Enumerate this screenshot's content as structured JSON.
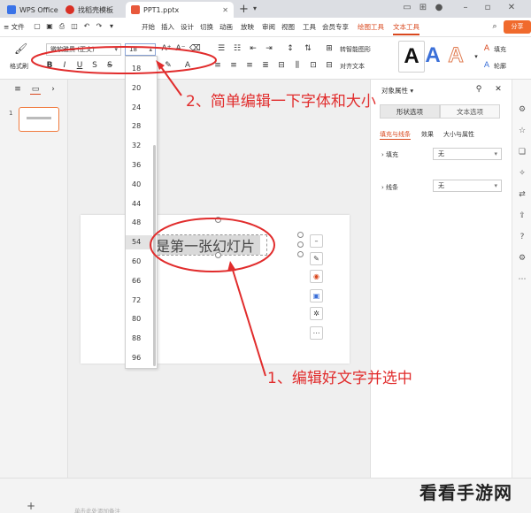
{
  "titlebar": {
    "tabs": [
      {
        "label": "WPS Office"
      },
      {
        "label": "找稻壳模板"
      },
      {
        "label": "PPT1.pptx"
      }
    ],
    "add_tab": "+"
  },
  "menubar": {
    "file": "≡ 文件",
    "items": [
      "开始",
      "插入",
      "设计",
      "切换",
      "动画",
      "放映",
      "审阅",
      "视图",
      "工具",
      "会员专享",
      "绘图工具",
      "文本工具"
    ],
    "share": "分享"
  },
  "ribbon": {
    "format_painter": "格式刷",
    "font_name": "微软雅黑 (正文)",
    "font_size": "18",
    "smart_graphic": "转智能图形",
    "align_text": "对齐文本",
    "style_glyph": "A",
    "fill": "填充",
    "outline": "轮廓"
  },
  "font_size_options": [
    "18",
    "20",
    "24",
    "28",
    "32",
    "36",
    "40",
    "44",
    "48",
    "54",
    "60",
    "66",
    "72",
    "80",
    "88",
    "96"
  ],
  "font_size_highlight": "54",
  "slide": {
    "number": "1",
    "text": "是第一张幻灯片"
  },
  "right_panel": {
    "title": "对象属性 ▾",
    "tabs": [
      "形状选项",
      "文本选项"
    ],
    "subtabs": [
      "填充与线条",
      "效果",
      "大小与属性"
    ],
    "fill_label": "填充",
    "fill_value": "无",
    "line_label": "线条",
    "line_value": "无"
  },
  "bottom": {
    "add": "+",
    "notes_hint": "单击此处添加备注"
  },
  "annotations": {
    "step2": "2、简单编辑一下字体和大小",
    "step1": "1、编辑好文字并选中"
  },
  "watermark": "看看手游网",
  "colors": {
    "accent": "#d9481e",
    "annotation": "#e12c2c",
    "share": "#f06a2d"
  }
}
